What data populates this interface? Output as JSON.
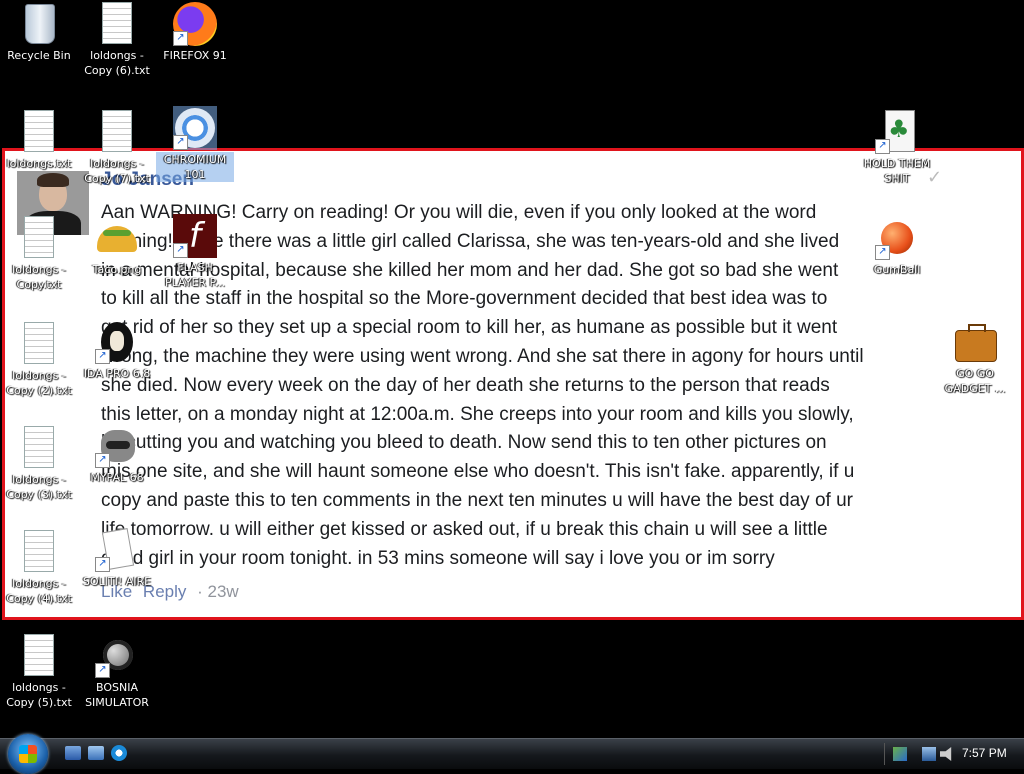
{
  "desktop": {
    "icons": [
      {
        "label": "Recycle Bin"
      },
      {
        "label": "loldongs - Copy (6).txt"
      },
      {
        "label": "FIREFOX 91"
      },
      {
        "label": "loldongs.txt"
      },
      {
        "label": "loldongs - Copy (7).txt"
      },
      {
        "label": "CHROMIUM 101"
      },
      {
        "label": "HOLD THEM SHIT"
      },
      {
        "label": "loldongs - Copy.txt"
      },
      {
        "label": "Taco.png"
      },
      {
        "label": "FLASH PLAYER P..."
      },
      {
        "label": "GumBall"
      },
      {
        "label": "loldongs - Copy (2).txt"
      },
      {
        "label": "IDA PRO 6.8"
      },
      {
        "label": "GO GO GADGET ..."
      },
      {
        "label": "loldongs - Copy (3).txt"
      },
      {
        "label": "MYPAL 68"
      },
      {
        "label": "loldongs - Copy (4).txt"
      },
      {
        "label": "SOLITI! AIRE"
      },
      {
        "label": "loldongs - Copy (5).txt"
      },
      {
        "label": "BOSNIA SIMULATOR"
      }
    ]
  },
  "wallpaper": {
    "author": "Jo Jansen",
    "comment": "Aan WARNING! Carry on reading! Or you will die, even if you only looked at the word\nwarning! Once there was a little girl called Clarissa, she was ten-years-old and she lived\nin a mental hospital, because she killed her mom and her dad. She got so bad she went\nto kill all the staff in the hospital so the More-government decided that best idea was to\nget rid of her so they set up a special room to kill her, as humane as possible but it went\nwrong, the machine they were using went wrong. And she sat there in agony for hours until\nshe died. Now every week on the day of her death she returns to the person that reads\nthis letter, on a monday night at 12:00a.m. She creeps into your room and kills you slowly,\nby cutting you and watching you bleed to death. Now send this to ten other pictures on\nthis one site, and she will haunt someone else who doesn't. This isn't fake. apparently, if u\ncopy and paste this to ten comments in the next ten minutes u will have the best day of ur\nlife tomorrow. u will either get kissed or asked out, if u break this chain u will see a little\ndead girl in your room tonight. in 53 mins someone will say i love you or im sorry",
    "like": "Like",
    "reply": "Reply",
    "age": "· 23w"
  },
  "taskbar": {
    "clock": "7:57 PM"
  }
}
